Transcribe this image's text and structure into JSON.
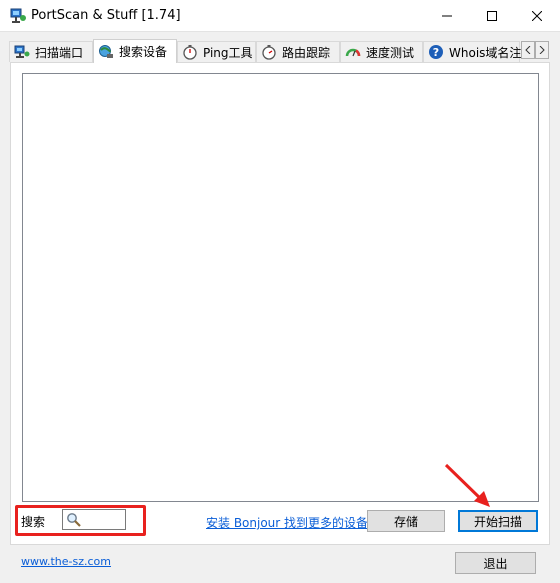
{
  "window": {
    "title": "PortScan & Stuff [1.74]"
  },
  "tabs": [
    {
      "label": "扫描端口",
      "icon": "network-computer-icon"
    },
    {
      "label": "搜索设备",
      "icon": "globe-network-icon"
    },
    {
      "label": "Ping工具",
      "icon": "stopwatch-icon"
    },
    {
      "label": "路由跟踪",
      "icon": "stopwatch-icon"
    },
    {
      "label": "速度测试",
      "icon": "speedometer-icon"
    },
    {
      "label": "Whois域名注",
      "icon": "help-circle-icon"
    }
  ],
  "active_tab_index": 1,
  "search": {
    "label": "搜索",
    "value": ""
  },
  "bonjour_link": "安装 Bonjour 找到更多的设备",
  "buttons": {
    "save": "存储",
    "start_scan": "开始扫描",
    "exit": "退出"
  },
  "footer": {
    "site_link": "www.the-sz.com"
  },
  "colors": {
    "highlight": "#e8211e",
    "link": "#0b5ed7",
    "focus": "#0078d7"
  }
}
